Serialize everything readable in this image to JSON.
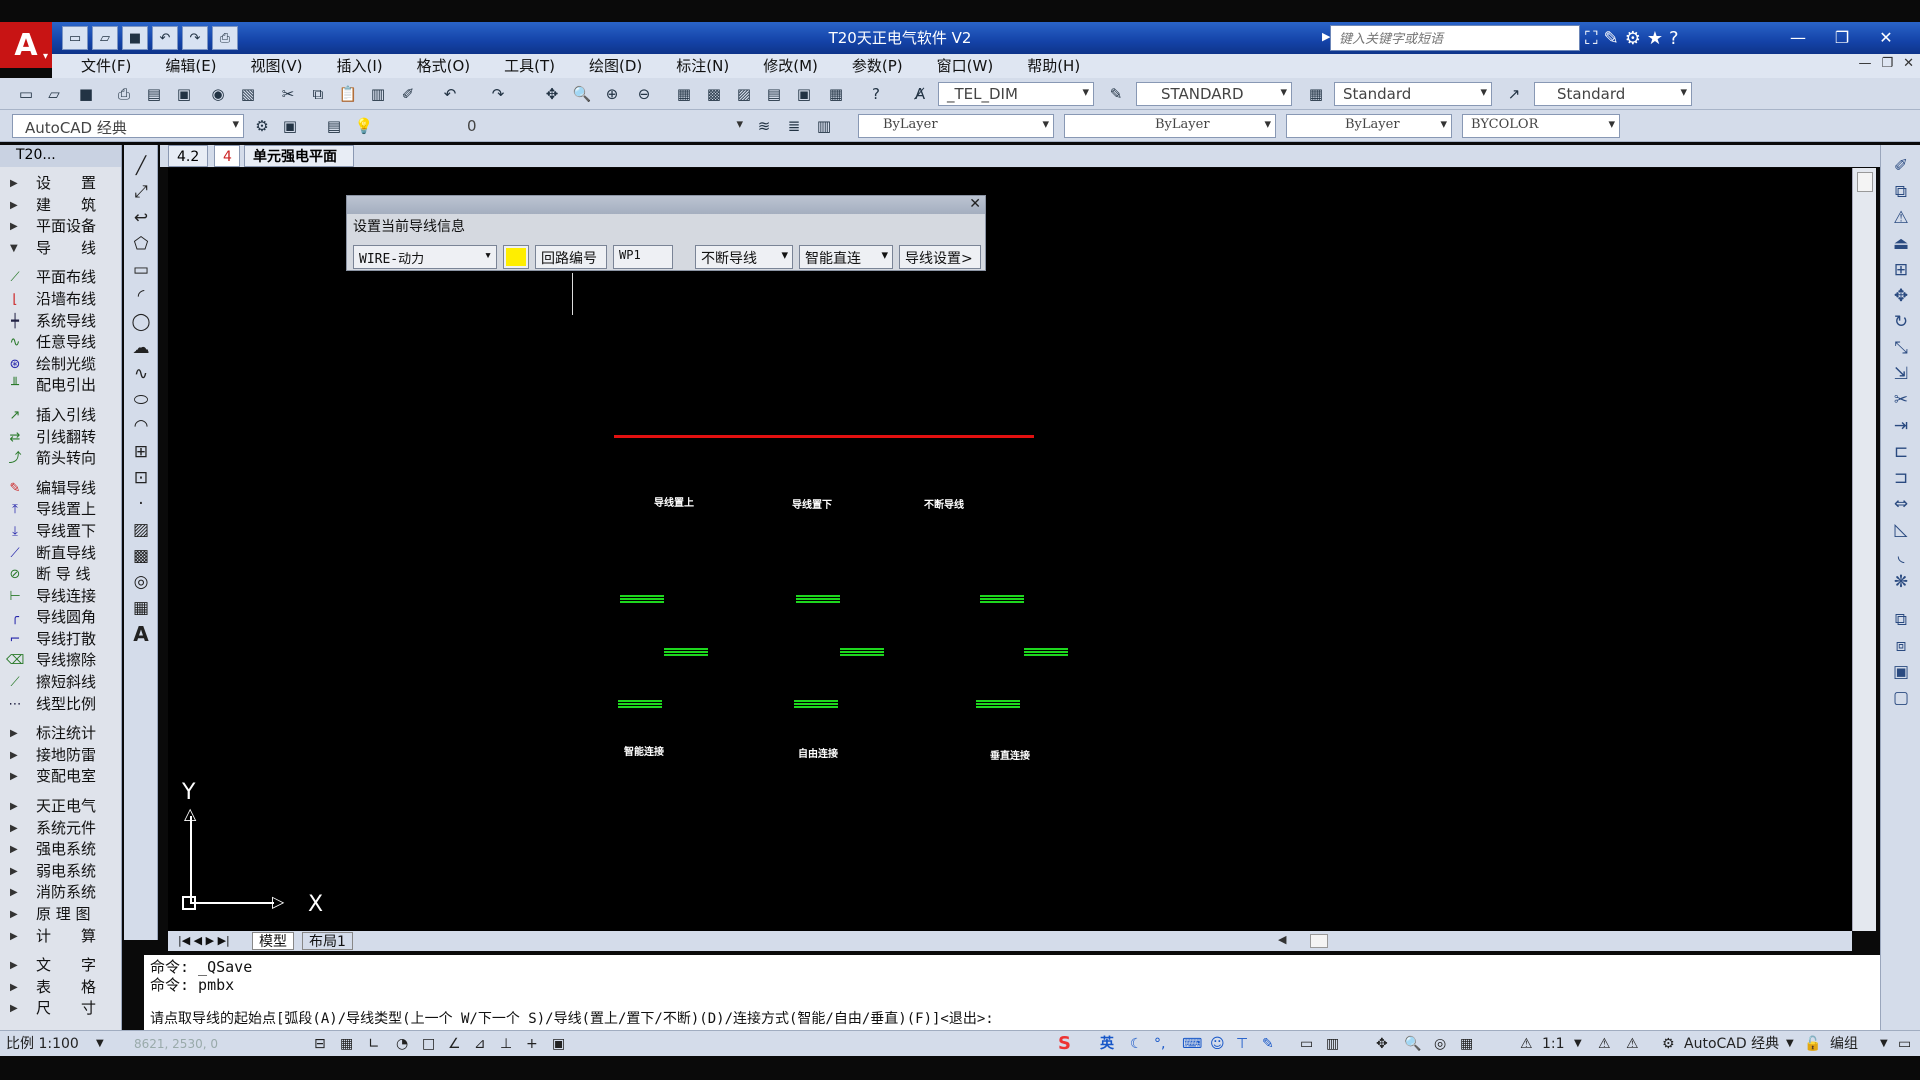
{
  "app": {
    "title": "T20天正电气软件 V2",
    "logo_letter": "A",
    "logo_caret": "▾",
    "search_placeholder": "键入关键字或短语"
  },
  "menu": [
    "文件(F)",
    "编辑(E)",
    "视图(V)",
    "插入(I)",
    "格式(O)",
    "工具(T)",
    "绘图(D)",
    "标注(N)",
    "修改(M)",
    "参数(P)",
    "窗口(W)",
    "帮助(H)"
  ],
  "toolbar1": {
    "dimstyle": "_TEL_DIM",
    "textstyle": "STANDARD",
    "tablestyle": "Standard",
    "mleaderstyle": "Standard"
  },
  "toolbar2": {
    "workspace": "AutoCAD 经典",
    "layer": "0",
    "color": "ByLayer",
    "linetype": "ByLayer",
    "lineweight": "ByLayer",
    "plotstyle": "BYCOLOR"
  },
  "left_panel": {
    "title": "T20...",
    "groups": [
      {
        "label": "设　　置",
        "type": "collapsed"
      },
      {
        "label": "建　　筑",
        "type": "collapsed"
      },
      {
        "label": "平面设备",
        "type": "collapsed"
      },
      {
        "label": "导　　线",
        "type": "expanded"
      }
    ],
    "items1": [
      "平面布线",
      "沿墙布线",
      "系统导线",
      "任意导线",
      "绘制光缆",
      "配电引出"
    ],
    "items2": [
      "插入引线",
      "引线翻转",
      "箭头转向"
    ],
    "items3": [
      "编辑导线",
      "导线置上",
      "导线置下",
      "断直导线",
      "断 导 线",
      "导线连接",
      "导线圆角",
      "导线打散",
      "导线擦除",
      "擦短斜线",
      "线型比例"
    ],
    "groups2": [
      "标注统计",
      "接地防雷",
      "变配电室"
    ],
    "groups3": [
      "天正电气",
      "系统元件",
      "强电系统",
      "弱电系统",
      "消防系统",
      "原 理 图",
      "计　　算"
    ],
    "groups4": [
      "文　　字",
      "表　　格",
      "尺　　寸"
    ]
  },
  "doc_tabs": {
    "zoom": "4.2",
    "num": "4",
    "name": "单元强电平面"
  },
  "dialog": {
    "title": "设置当前导线信息",
    "wire_type": "WIRE-动力",
    "color": "#ffee00",
    "circuit_btn": "回路编号",
    "circuit_value": "WP1",
    "break_mode": "不断导线",
    "connect_mode": "智能直连",
    "settings_btn": "导线设置>"
  },
  "drawing": {
    "labels": [
      "导线置上",
      "导线置下",
      "不断导线",
      "智能连接",
      "自由连接",
      "垂直连接"
    ],
    "ucs_y": "Y",
    "ucs_x": "X"
  },
  "model_tabs": [
    "模型",
    "布局1"
  ],
  "command": {
    "lines": [
      "命令: _QSave",
      "命令: pmbx"
    ],
    "prompt": "请点取导线的起始点[弧段(A)/导线类型(上一个 W/下一个 S)/导线(置上/置下/不断)(D)/连接方式(智能/自由/垂直)(F)]<退出>:"
  },
  "status": {
    "scale": "比例 1:100",
    "coords": "8621, 2530, 0",
    "ime": "英",
    "anno_scale": "1:1",
    "workspace": "AutoCAD 经典",
    "mode": "编组"
  }
}
